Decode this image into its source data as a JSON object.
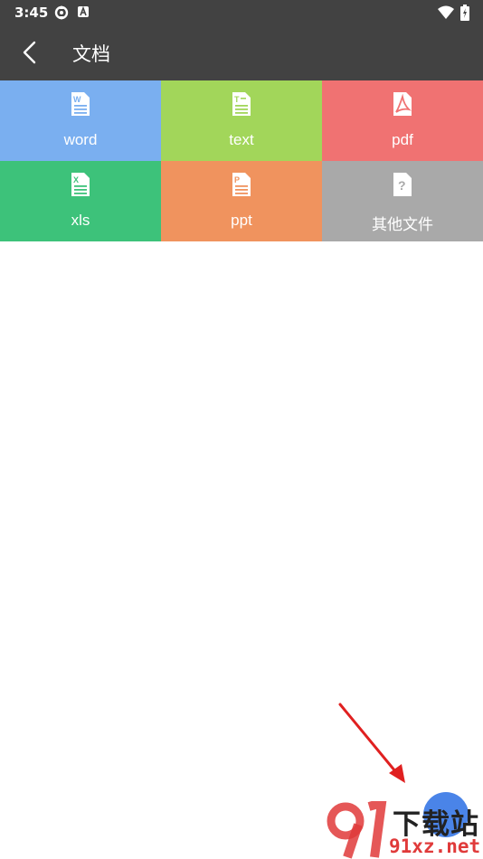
{
  "status_bar": {
    "time": "3:45"
  },
  "toolbar": {
    "title": "文档"
  },
  "categories": [
    {
      "label": "word",
      "color": "#7aaff0",
      "icon": "word-doc-icon"
    },
    {
      "label": "text",
      "color": "#a2d65a",
      "icon": "text-doc-icon"
    },
    {
      "label": "pdf",
      "color": "#f07272",
      "icon": "pdf-doc-icon"
    },
    {
      "label": "xls",
      "color": "#3dc27a",
      "icon": "xls-doc-icon"
    },
    {
      "label": "ppt",
      "color": "#f0935e",
      "icon": "ppt-doc-icon"
    },
    {
      "label": "其他文件",
      "color": "#a9a9a9",
      "icon": "other-doc-icon"
    }
  ],
  "colors": {
    "bar": "#424242",
    "fab": "#4a84e8",
    "arrow": "#e02020"
  },
  "watermark": {
    "brand_cn": "下载站",
    "domain": "91xz.net"
  }
}
